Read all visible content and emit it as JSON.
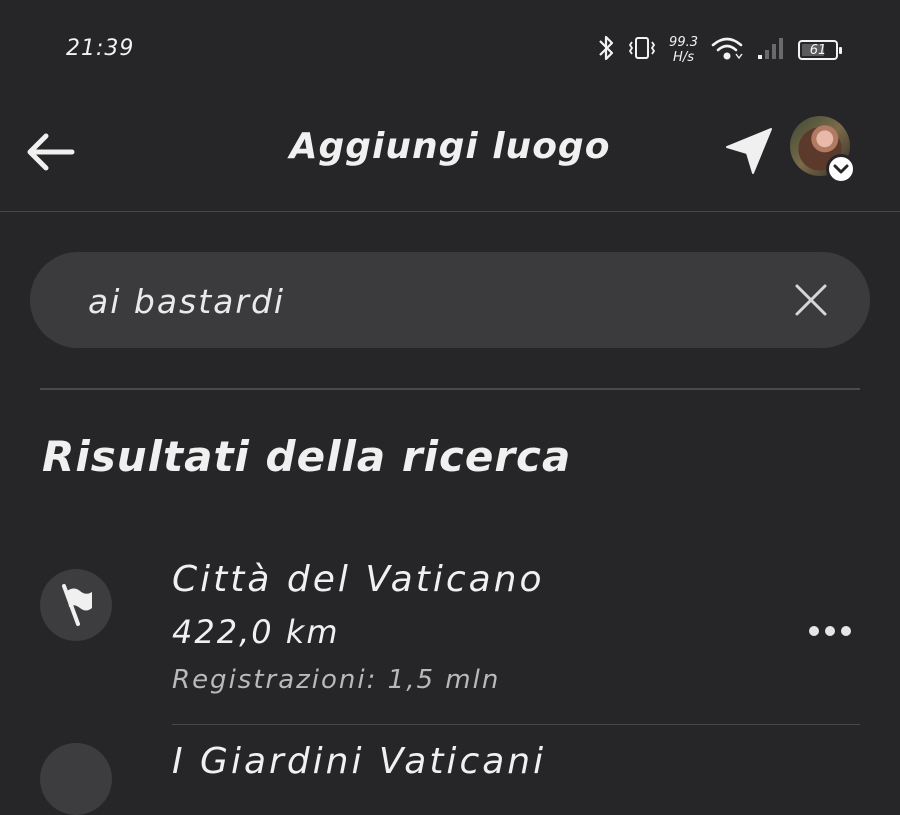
{
  "status_bar": {
    "time": "21:39",
    "net_speed_value": "99.3",
    "net_speed_unit": "H/s",
    "battery": "61",
    "icons": [
      "bluetooth-icon",
      "vibrate-icon",
      "wifi-icon",
      "signal-icon",
      "battery-icon"
    ]
  },
  "header": {
    "title": "Aggiungi luogo",
    "icons": [
      "back-arrow-icon",
      "location-arrow-icon",
      "avatar",
      "chevron-down-icon"
    ]
  },
  "search": {
    "value": "ai bastardi",
    "icon": "close-icon"
  },
  "results": {
    "section_title": "Risultati della ricerca",
    "items": [
      {
        "name": "Città del Vaticano",
        "distance": "422,0 km",
        "registrations": "Registrazioni: 1,5 mln",
        "icon": "flag-icon"
      },
      {
        "name": "I Giardini Vaticani",
        "icon": "flag-icon"
      }
    ]
  },
  "colors": {
    "background": "#262628",
    "search_bg": "#3b3b3e",
    "text": "#f0f0f0",
    "muted_text": "#b9b9bc"
  }
}
